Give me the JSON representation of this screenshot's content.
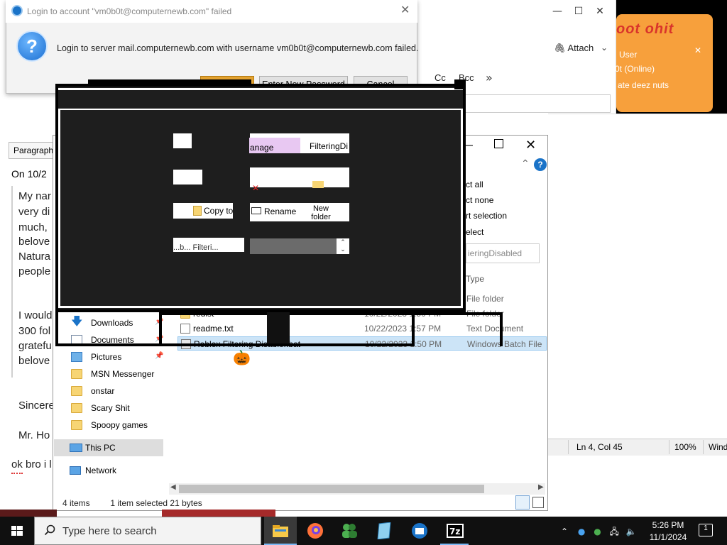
{
  "login_dialog": {
    "title": "Login to account \"vm0b0t@computernewb.com\" failed",
    "message": "Login to server mail.computernewb.com with username vm0b0t@computernewb.com failed.",
    "buttons": {
      "enter_new_password": "Enter New Password",
      "cancel": "Cancel"
    }
  },
  "compose": {
    "attach_label": "Attach",
    "cc_label": "Cc",
    "bcc_label": "Bcc",
    "paragraph_label": "Paragraph",
    "body_on": "On 10/2",
    "body_lines": [
      "My nar",
      "very di",
      "much,",
      "belove",
      "Natura",
      "people",
      "I would",
      "300 fol",
      "gratefu",
      "belove",
      "Sincere",
      "Mr. Ho"
    ],
    "reply_text": "ok bro i l"
  },
  "messenger_popup": {
    "header": "oot ohit",
    "user": "User",
    "status": "0t (Online)",
    "message": "ate deez nuts"
  },
  "editor_status": {
    "position": "Ln 4, Col 45",
    "zoom": "100%",
    "eol": "Wind"
  },
  "explorer": {
    "ribbon": {
      "select_all": "ct all",
      "select_none": "ct none",
      "invert_selection": "rt selection",
      "select_label": "elect"
    },
    "search_placeholder": "ieringDisabled",
    "column_type": "Type",
    "nav": {
      "downloads": "Downloads",
      "documents": "Documents",
      "pictures": "Pictures",
      "msn_messenger": "MSN Messenger",
      "onstar": "onstar",
      "scary_shit": "Scary Shit",
      "spoopy_games": "Spoopy games",
      "this_pc": "This PC",
      "network": "Network"
    },
    "files": [
      {
        "name": "",
        "date": "",
        "type": "File folder"
      },
      {
        "name": "redist",
        "date": "10/22/2023 1:50 PM",
        "type": "File folder"
      },
      {
        "name": "readme.txt",
        "date": "10/22/2023 1:57 PM",
        "type": "Text Document"
      },
      {
        "name": "Roblox Filtering Disabler.bat",
        "date": "10/22/2023 1:50 PM",
        "type": "Windows Batch File"
      }
    ],
    "status": {
      "items": "4 items",
      "selected": "1 item selected  21 bytes"
    }
  },
  "glitch_fragments": {
    "manage": "anage",
    "filtering": "FilteringDi",
    "copy_to": "Copy to",
    "rename": "Rename",
    "new_folder": "New folder",
    "filtering_bottom": "...b... Filteri..."
  },
  "taskbar": {
    "search_placeholder": "Type here to search",
    "time": "5:26 PM",
    "date": "11/1/2024",
    "notifications": "1"
  },
  "colors": {
    "accent": "#1a73c8",
    "popup_orange": "#f7a03c",
    "selection": "#cce4f7",
    "taskbar": "#101010"
  }
}
